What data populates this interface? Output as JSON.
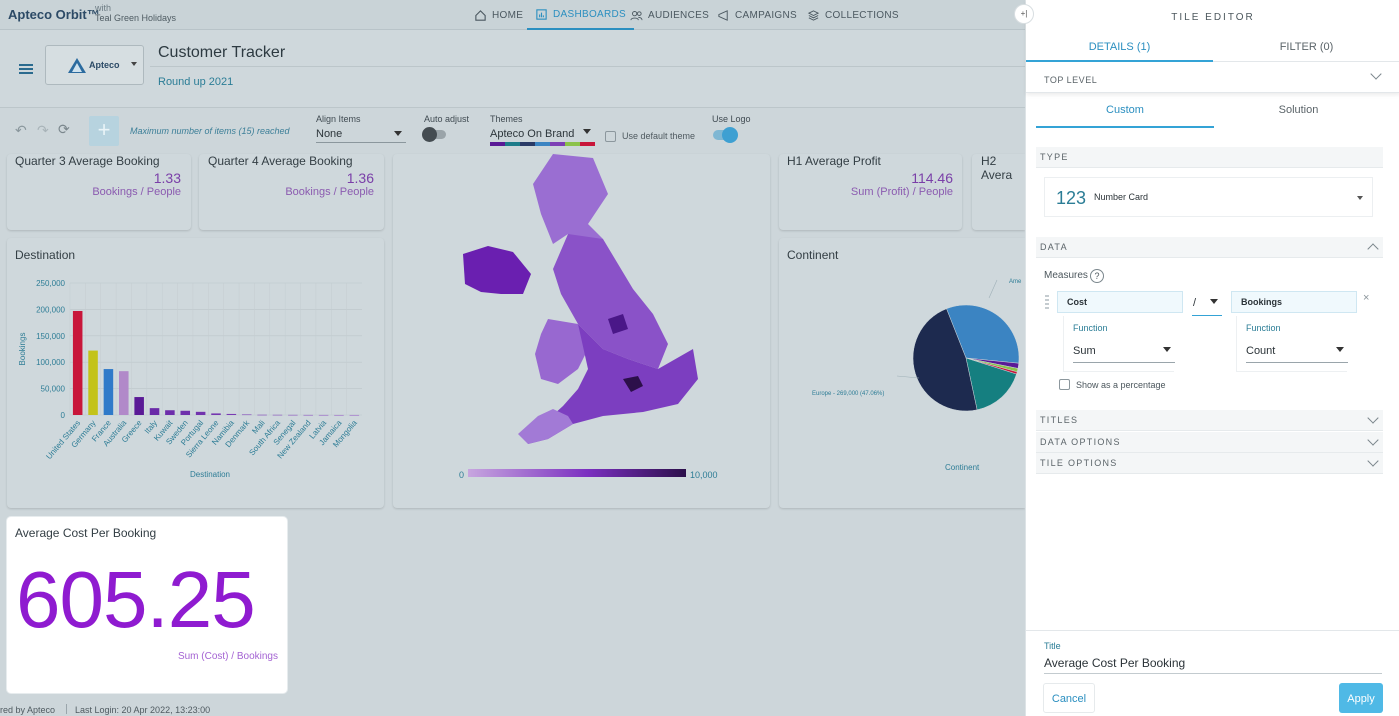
{
  "app": {
    "brand": "Apteco Orbit™",
    "with_label": "with",
    "org": "Teal Green Holidays"
  },
  "nav": [
    {
      "label": "HOME",
      "icon": "home-icon"
    },
    {
      "label": "DASHBOARDS",
      "icon": "dashboard-icon"
    },
    {
      "label": "AUDIENCES",
      "icon": "audiences-icon"
    },
    {
      "label": "CAMPAIGNS",
      "icon": "campaigns-icon"
    },
    {
      "label": "COLLECTIONS",
      "icon": "collections-icon"
    }
  ],
  "header": {
    "title": "Customer Tracker",
    "subtitle": "Round up 2021",
    "logo_text": "Apteco"
  },
  "toolbar": {
    "max_items": "Maximum number of items (15) reached",
    "align_label": "Align Items",
    "align_value": "None",
    "auto_adjust_label": "Auto adjust",
    "themes_label": "Themes",
    "themes_value": "Apteco On Brand",
    "default_theme_label": "Use default theme",
    "use_logo_label": "Use Logo"
  },
  "cards": {
    "q3": {
      "title": "Quarter 3 Average Booking",
      "value": "1.33",
      "sub": "Bookings / People"
    },
    "q4": {
      "title": "Quarter 4 Average Booking",
      "value": "1.36",
      "sub": "Bookings / People"
    },
    "h1": {
      "title": "H1 Average Profit",
      "value": "114.46",
      "sub": "Sum (Profit) / People"
    },
    "h2": {
      "title": "H2 Avera"
    },
    "continent": {
      "title": "Continent",
      "xlabel": "Continent",
      "label_europe": "Europe - 269,000 (47.06%)",
      "label_america": "Ame"
    },
    "map": {
      "legend_min": "0",
      "legend_max": "10,000"
    },
    "avgcost": {
      "title": "Average Cost Per Booking",
      "value": "605.25",
      "sub": "Sum (Cost) / Bookings"
    }
  },
  "chart_data": [
    {
      "type": "bar",
      "title": "Destination",
      "xlabel": "Destination",
      "ylabel": "Bookings",
      "ylim": [
        0,
        250000
      ],
      "yticks": [
        "0",
        "50,000",
        "100,000",
        "150,000",
        "200,000",
        "250,000"
      ],
      "categories": [
        "United States",
        "Germany",
        "France",
        "Australia",
        "Greece",
        "Italy",
        "Kuwait",
        "Sweden",
        "Portugal",
        "Sierra Leone",
        "Namibia",
        "Denmark",
        "Mali",
        "South Africa",
        "Senegal",
        "New Zealand",
        "Latvia",
        "Jamaica",
        "Mongolia"
      ],
      "values": [
        197000,
        122000,
        87000,
        83000,
        34000,
        13000,
        9000,
        8000,
        6000,
        3000,
        2000,
        1000,
        500,
        400,
        300,
        200,
        150,
        100,
        80
      ],
      "colors": [
        "#c8163a",
        "#c3c31a",
        "#2f7ac9",
        "#b189c9",
        "#5a1a96",
        "#6a2aa8",
        "#6d2dab",
        "#6f30ac",
        "#7233ae",
        "#7536b0",
        "#7a3bb3",
        "#7e40b6",
        "#8245b9",
        "#864abb",
        "#8a4fbe",
        "#8e54c0",
        "#9259c3",
        "#965ec5",
        "#9a63c8"
      ]
    },
    {
      "type": "pie",
      "title": "Continent",
      "values": [
        269000,
        185000,
        95000,
        9000,
        6000,
        4000
      ],
      "categories": [
        "Europe",
        "America",
        "Other",
        "",
        "",
        ""
      ],
      "colors": [
        "#1d2a4f",
        "#3b84c2",
        "#157f80",
        "#5a1a96",
        "#8bc24a",
        "#c8163a"
      ]
    }
  ],
  "editor": {
    "title": "TILE EDITOR",
    "tab_details": "DETAILS (1)",
    "tab_filter": "FILTER (0)",
    "level": "TOP LEVEL",
    "sub_custom": "Custom",
    "sub_solution": "Solution",
    "sec_type": "TYPE",
    "type_icon_text": "123",
    "type_value": "Number Card",
    "sec_data": "DATA",
    "measures_label": "Measures",
    "help_text": "?",
    "measure_left": "Cost",
    "operator": "/",
    "measure_right": "Bookings",
    "function_label": "Function",
    "function_left": "Sum",
    "function_right": "Count",
    "show_pct": "Show as a percentage",
    "sec_titles": "TITLES",
    "sec_data_options": "DATA OPTIONS",
    "sec_tile_options": "TILE OPTIONS",
    "title_label": "Title",
    "title_value": "Average Cost Per Booking",
    "cancel": "Cancel",
    "apply": "Apply"
  },
  "footer": {
    "powered": "red by Apteco",
    "last_login": "Last Login: 20 Apr 2022, 13:23:00"
  }
}
